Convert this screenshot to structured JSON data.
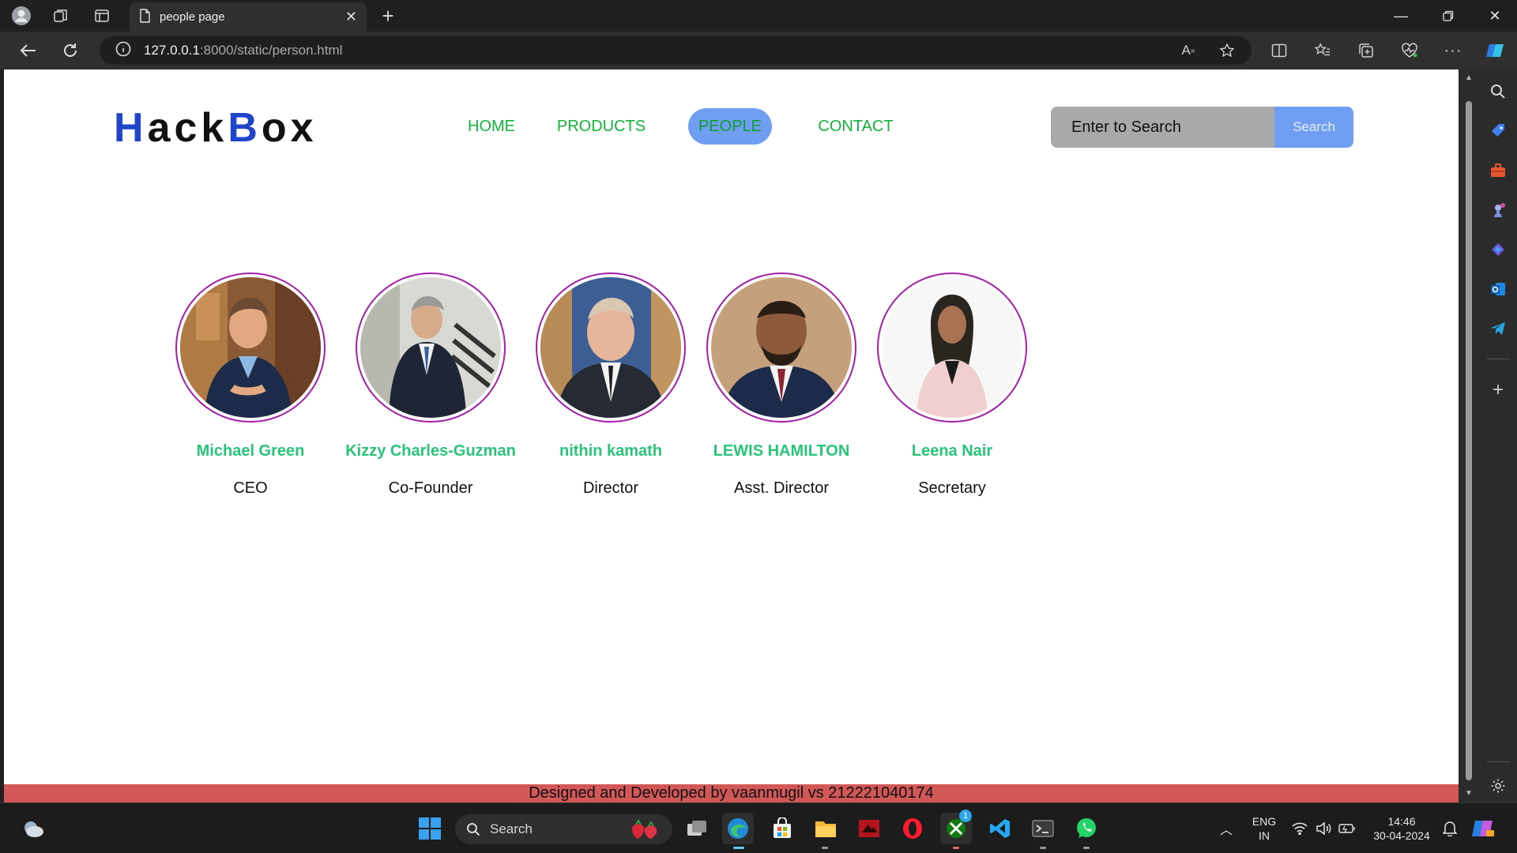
{
  "browser": {
    "tab_title": "people page",
    "url_host": "127.0.0.1",
    "url_path": ":8000/static/person.html"
  },
  "site": {
    "logo_h": "H",
    "logo_ack": "ack",
    "logo_b": "B",
    "logo_ox": "ox",
    "nav": [
      {
        "label": "HOME"
      },
      {
        "label": "PRODUCTS"
      },
      {
        "label": "PEOPLE"
      },
      {
        "label": "CONTACT"
      }
    ],
    "active_nav": "PEOPLE",
    "search_placeholder": "Enter to Search",
    "search_button": "Search",
    "people": [
      {
        "name": "Michael Green",
        "role": "CEO"
      },
      {
        "name": "Kizzy Charles-Guzman",
        "role": "Co-Founder"
      },
      {
        "name": "nithin kamath",
        "role": "Director"
      },
      {
        "name": "LEWIS HAMILTON",
        "role": "Asst. Director"
      },
      {
        "name": "Leena Nair",
        "role": "Secretary"
      }
    ],
    "footer": "Designed and Developed by vaanmugil vs 212221040174"
  },
  "taskbar": {
    "search_label": "Search",
    "lang_top": "ENG",
    "lang_bottom": "IN",
    "time": "14:46",
    "date": "30-04-2024",
    "xbox_badge": "1"
  },
  "colors": {
    "accent_blue": "#1f45c8",
    "nav_green": "#11b43a",
    "name_green": "#27c47a",
    "active_pill": "#6f9ef2",
    "avatar_ring": "#a31fa8",
    "footer_bg": "#d25757"
  }
}
